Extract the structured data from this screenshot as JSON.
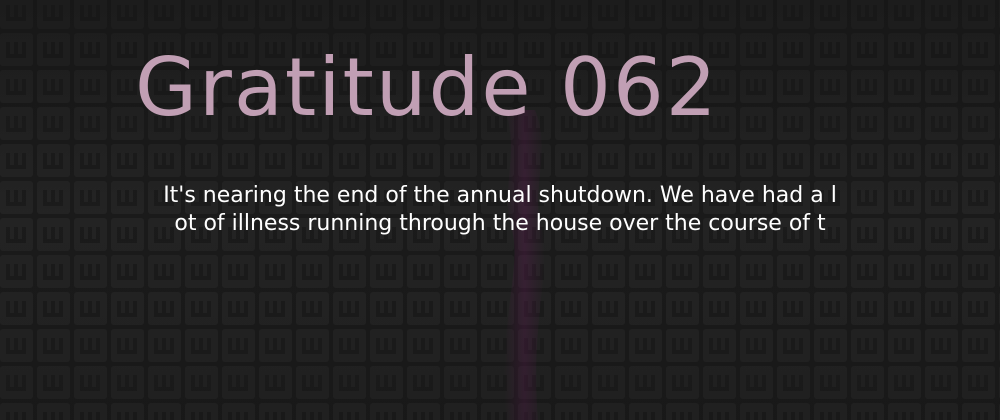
{
  "banner": {
    "title": "Gratitude 062",
    "excerpt_lines": [
      "It's nearing the end of the annual shutdown. We have had a l",
      "ot of illness running through the house over the course of t"
    ]
  },
  "colors": {
    "background": "#1b1b1b",
    "tile": "#2a2a2a",
    "tile_glyph": "#1f1f1f",
    "accent_glow": "#5a1e4e",
    "title": "#c19fb4",
    "text": "#ffffff"
  },
  "decoration": {
    "background_pattern": "repeating-square-glyph-tiles",
    "accent": "magenta-vertical-glow"
  }
}
